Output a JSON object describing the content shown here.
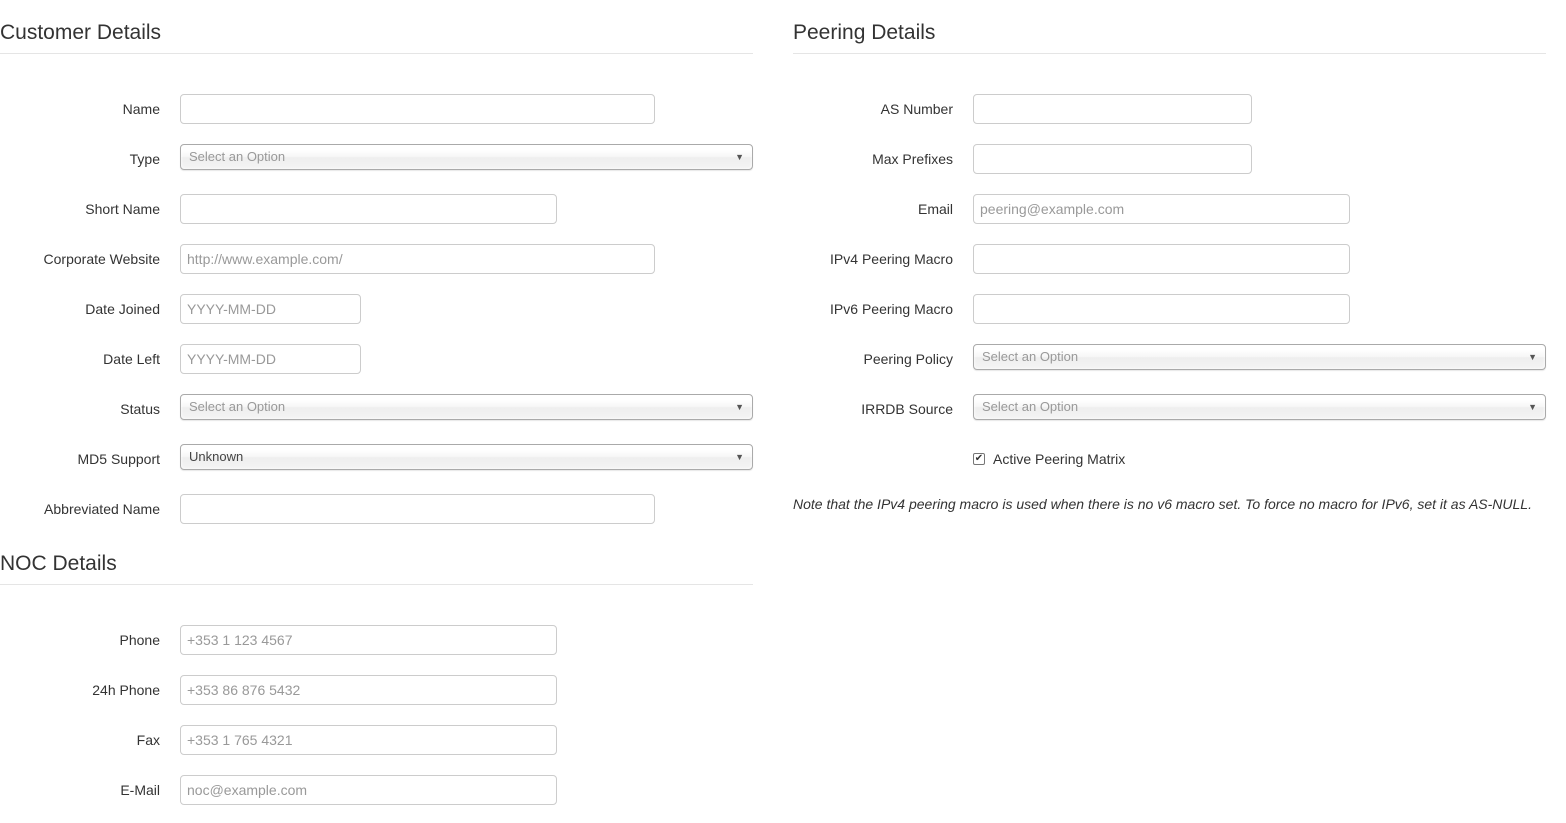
{
  "customer": {
    "title": "Customer Details",
    "name_label": "Name",
    "type_label": "Type",
    "type_value": "Select an Option",
    "short_name_label": "Short Name",
    "website_label": "Corporate Website",
    "website_placeholder": "http://www.example.com/",
    "date_joined_label": "Date Joined",
    "date_joined_placeholder": "YYYY-MM-DD",
    "date_left_label": "Date Left",
    "date_left_placeholder": "YYYY-MM-DD",
    "status_label": "Status",
    "status_value": "Select an Option",
    "md5_label": "MD5 Support",
    "md5_value": "Unknown",
    "abbrev_label": "Abbreviated Name"
  },
  "noc": {
    "title": "NOC Details",
    "phone_label": "Phone",
    "phone_placeholder": "+353 1 123 4567",
    "phone24_label": "24h Phone",
    "phone24_placeholder": "+353 86 876 5432",
    "fax_label": "Fax",
    "fax_placeholder": "+353 1 765 4321",
    "email_label": "E-Mail",
    "email_placeholder": "noc@example.com"
  },
  "peering": {
    "title": "Peering Details",
    "asn_label": "AS Number",
    "max_prefixes_label": "Max Prefixes",
    "email_label": "Email",
    "email_placeholder": "peering@example.com",
    "ipv4_macro_label": "IPv4 Peering Macro",
    "ipv6_macro_label": "IPv6 Peering Macro",
    "policy_label": "Peering Policy",
    "policy_value": "Select an Option",
    "irrdb_label": "IRRDB Source",
    "irrdb_value": "Select an Option",
    "active_matrix_label": "Active Peering Matrix",
    "active_matrix_checked": true,
    "note": "Note that the IPv4 peering macro is used when there is no v6 macro set. To force no macro for IPv6, set it as AS-NULL."
  },
  "icons": {
    "dropdown_arrow": "▼",
    "checkmark": "✔"
  }
}
